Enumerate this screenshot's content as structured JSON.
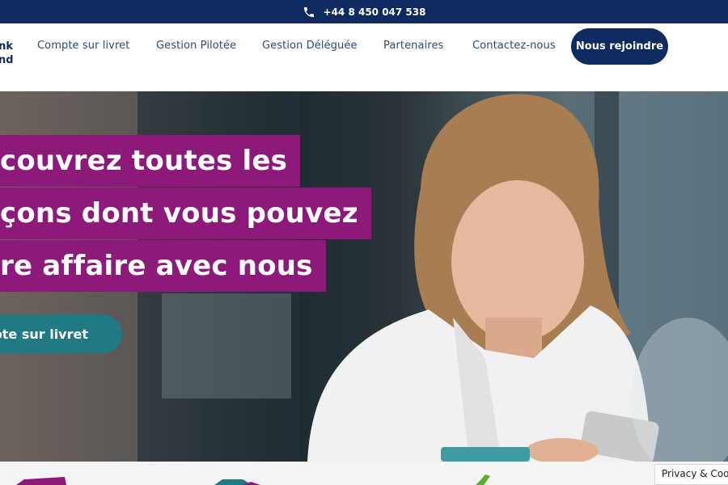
{
  "topbar": {
    "phone": "+44 8 450 047 538",
    "icon": "phone-icon"
  },
  "logo": {
    "line1": "nk",
    "line2": "nd"
  },
  "nav": {
    "items": [
      {
        "label": "Compte sur livret"
      },
      {
        "label": "Gestion Pilotée"
      },
      {
        "label": "Gestion Déléguée"
      },
      {
        "label": "Partenaires"
      },
      {
        "label": "Contactez-nous"
      }
    ],
    "join": "Nous rejoindre"
  },
  "hero": {
    "headline": [
      "couvrez toutes les",
      "çons dont vous pouvez",
      "re affaire avec nous"
    ],
    "cta": "pte sur livret"
  },
  "cookie": {
    "label": "Privacy & Coo"
  },
  "colors": {
    "navy": "#0d2b5e",
    "magenta": "#8c1a7a",
    "teal": "#1f7a84",
    "nav_text": "#2e4b6e"
  }
}
